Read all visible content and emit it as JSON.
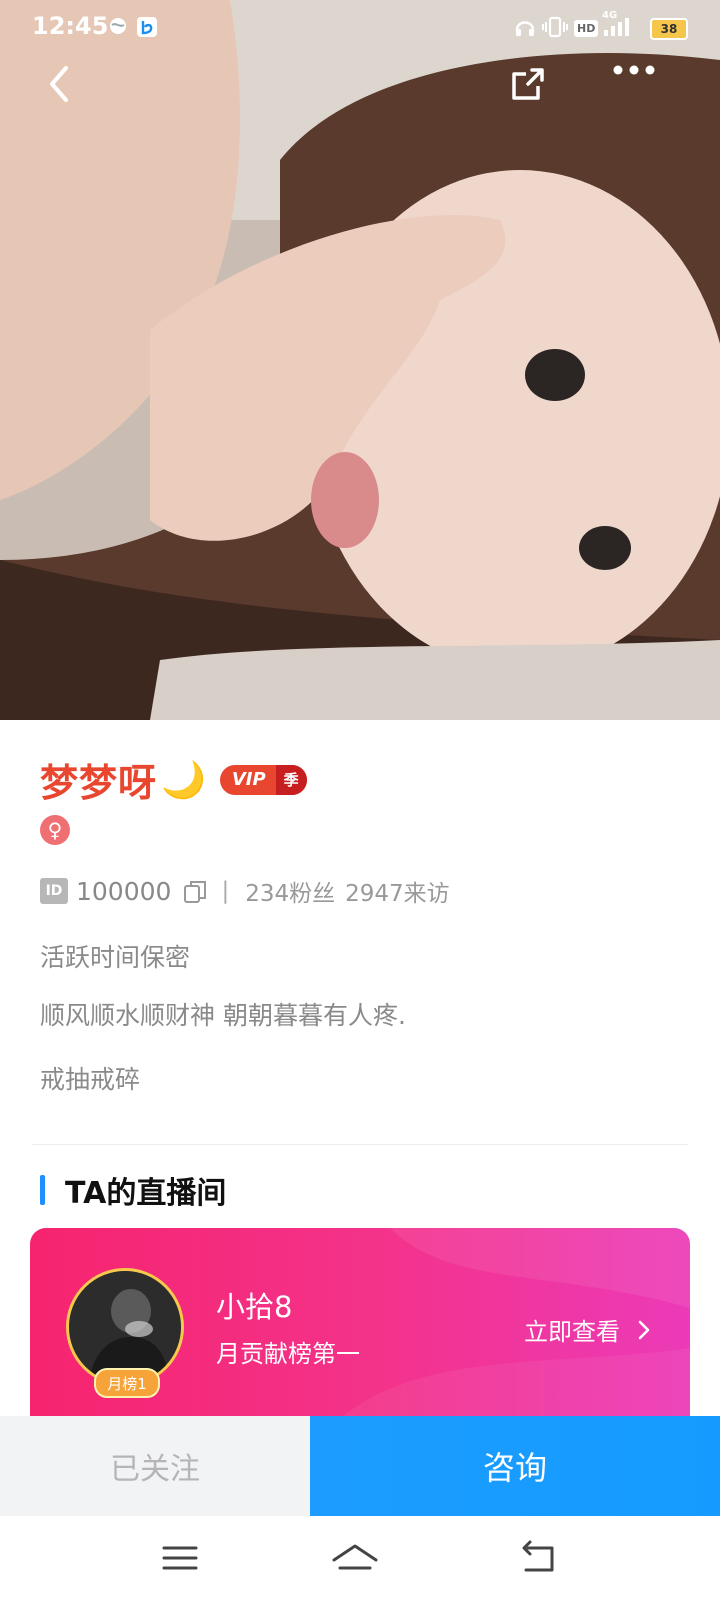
{
  "status_bar": {
    "time": "12:45",
    "battery": "38",
    "network": "4G",
    "hd_label": "HD"
  },
  "header": {
    "back_icon": "chevron-left-icon",
    "share_icon": "share-icon",
    "more_icon": "more-dots-icon"
  },
  "profile": {
    "name": "梦梦呀",
    "name_emoji": "🌙",
    "vip_label": "VIP",
    "vip_season": "季",
    "gender_symbol": "♀",
    "id_label": "ID",
    "id_value": "100000",
    "fans": "234粉丝",
    "visits": "2947来访",
    "active_time": "活跃时间保密",
    "signature": "顺风顺水顺财神  朝朝暮暮有人疼.",
    "tags": "戒抽戒碎"
  },
  "live_section": {
    "title": "TA的直播间",
    "host_name": "小拾8",
    "host_sub": "月贡献榜第一",
    "rank_badge": "月榜1",
    "view_label": "立即查看"
  },
  "actions": {
    "followed_label": "已关注",
    "consult_label": "咨询"
  },
  "colors": {
    "name_color": "#e8462e",
    "accent_blue": "#1c9cff",
    "card_pink": "#f6246f"
  }
}
